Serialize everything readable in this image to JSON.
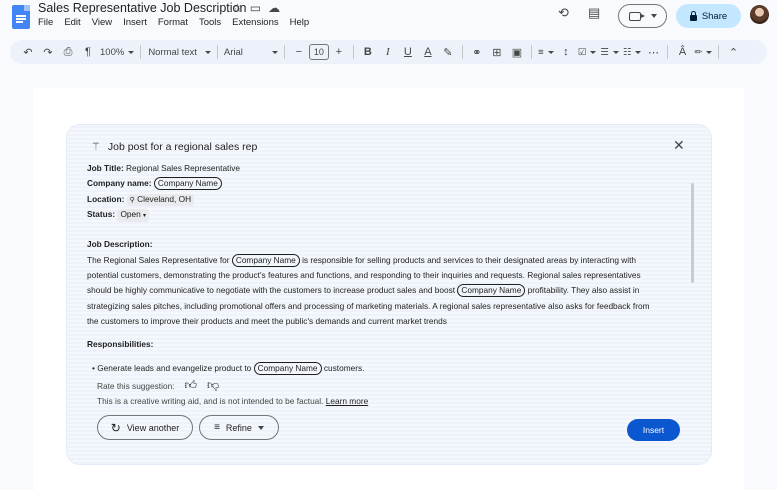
{
  "window": {
    "doc_title": "Sales Representative Job Description",
    "share_label": "Share",
    "menus": [
      "File",
      "Edit",
      "View",
      "Insert",
      "Format",
      "Tools",
      "Extensions",
      "Help"
    ]
  },
  "toolbar": {
    "zoom": "100%",
    "style": "Normal text",
    "font": "Arial",
    "font_size": "10"
  },
  "panel": {
    "title": "Job post for a regional sales rep",
    "job_title_label": "Job Title:",
    "job_title_value": "Regional Sales Representative",
    "company_label": "Company name:",
    "company_chip": "Company Name",
    "location_label": "Location:",
    "location_value": "Cleveland, OH",
    "status_label": "Status:",
    "status_value": "Open",
    "description_label": "Job Description:",
    "desc_1a": "The Regional Sales Representative for",
    "desc_1b": "is responsible for selling products and services to their designated areas by interacting with",
    "desc_2": "potential customers, demonstrating the product's features and functions, and responding to their inquiries and requests. Regional sales representatives",
    "desc_3a": "should be highly communicative to negotiate with the customers to increase product sales and boost",
    "desc_3b": "profitability. They also assist in",
    "desc_4": "strategizing sales pitches, including promotional offers and processing of marketing materials. A regional sales representative also asks for feedback from",
    "desc_5": "the customers to improve their products and meet the public's demands and current market trends",
    "responsibilities_label": "Responsibilities:",
    "resp_1a": "Generate leads and evangelize product to",
    "resp_1b": "customers.",
    "rate_label": "Rate this suggestion:",
    "disclaimer": "This is a creative writing aid, and is not intended to be factual.",
    "learn_more": "Learn more",
    "view_another": "View another",
    "refine": "Refine",
    "insert": "Insert"
  },
  "colors": {
    "accent": "#0b57d0",
    "share_bg": "#c2e7ff",
    "toolbar_bg": "#edf2fa",
    "doc_icon": "#4285f4"
  }
}
